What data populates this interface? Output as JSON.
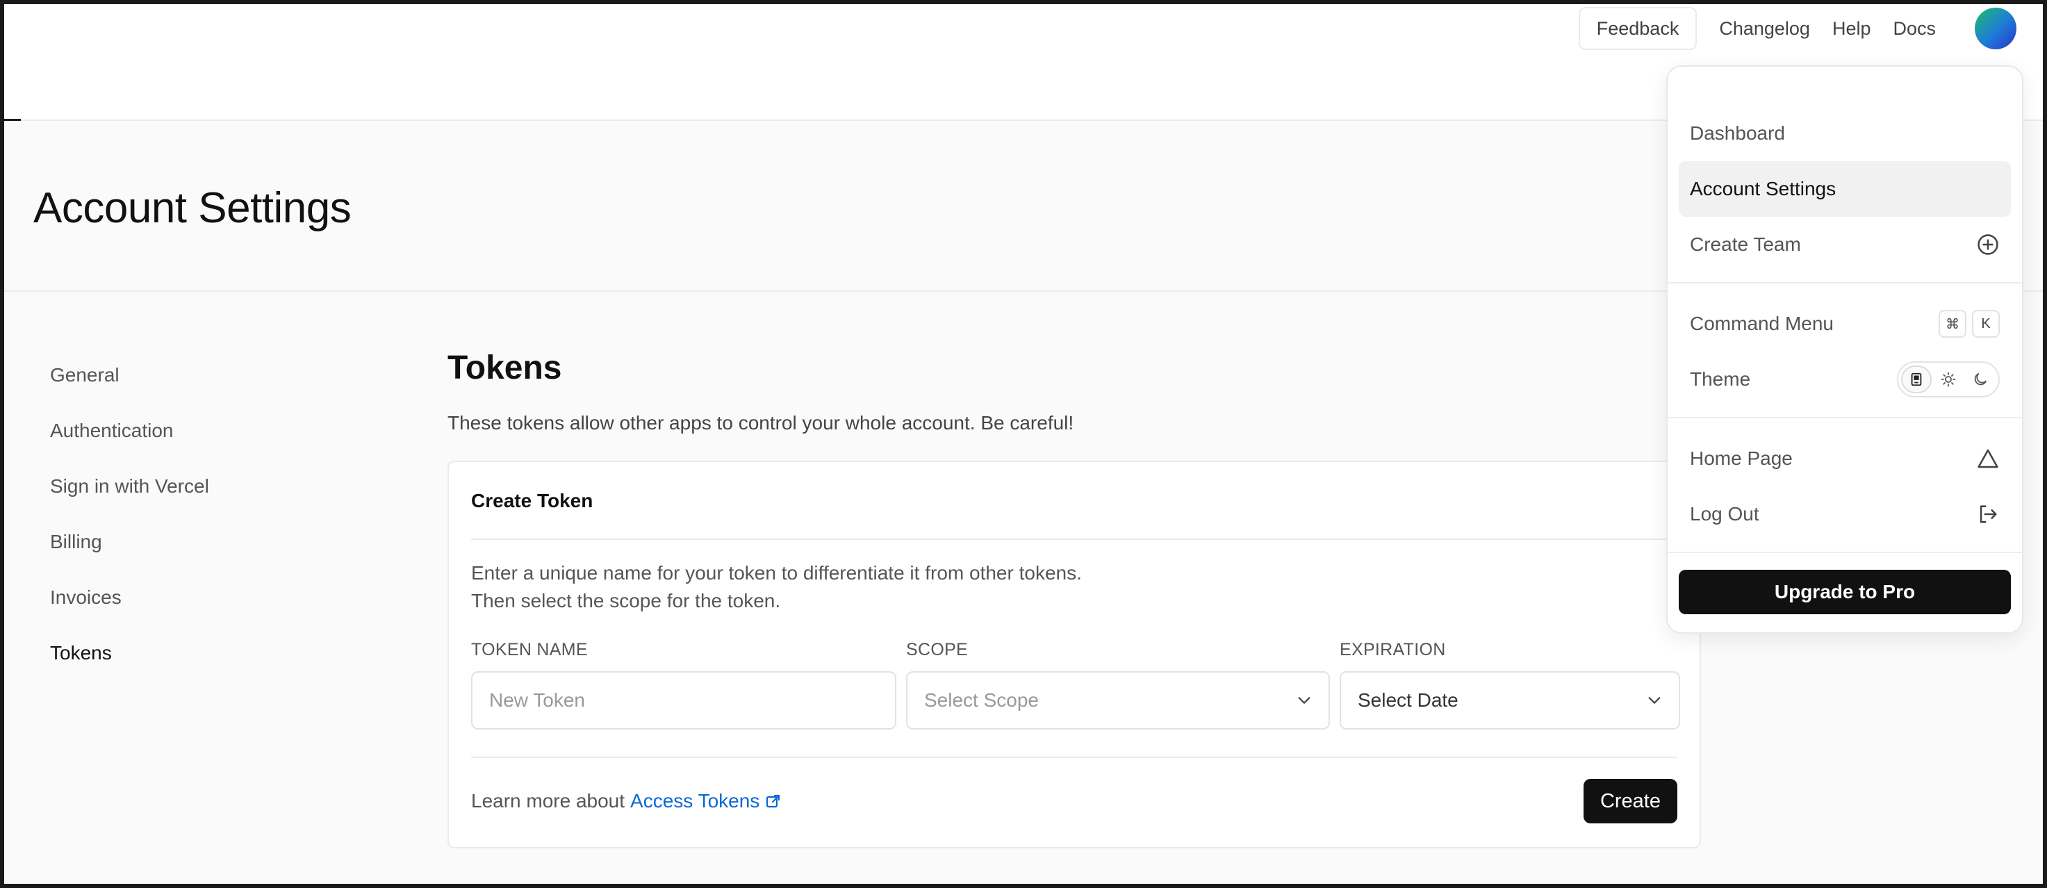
{
  "topnav": {
    "feedback_label": "Feedback",
    "links": [
      "Changelog",
      "Help",
      "Docs"
    ]
  },
  "page": {
    "title": "Account Settings"
  },
  "sidebar": {
    "items": [
      {
        "label": "General"
      },
      {
        "label": "Authentication"
      },
      {
        "label": "Sign in with Vercel"
      },
      {
        "label": "Billing"
      },
      {
        "label": "Invoices"
      },
      {
        "label": "Tokens"
      }
    ],
    "active": "Tokens"
  },
  "tokens": {
    "title": "Tokens",
    "description": "These tokens allow other apps to control your whole account. Be careful!",
    "card": {
      "title": "Create Token",
      "desc_line1": "Enter a unique name for your token to differentiate it from other tokens.",
      "desc_line2": "Then select the scope for the token.",
      "fields": {
        "name_label": "TOKEN NAME",
        "name_placeholder": "New Token",
        "scope_label": "SCOPE",
        "scope_value": "Select Scope",
        "expiration_label": "EXPIRATION",
        "expiration_value": "Select Date"
      },
      "learn_prefix": "Learn more about",
      "learn_link": "Access Tokens",
      "create_label": "Create"
    }
  },
  "menu": {
    "items": {
      "dashboard": "Dashboard",
      "account_settings": "Account Settings",
      "create_team": "Create Team",
      "command_menu": "Command Menu",
      "theme": "Theme",
      "home_page": "Home Page",
      "log_out": "Log Out"
    },
    "shortcut_keys": [
      "⌘",
      "K"
    ],
    "upgrade_label": "Upgrade to Pro",
    "theme_selected": "system"
  },
  "colors": {
    "accent_link": "#0b67d8",
    "primary_button": "#111111"
  }
}
